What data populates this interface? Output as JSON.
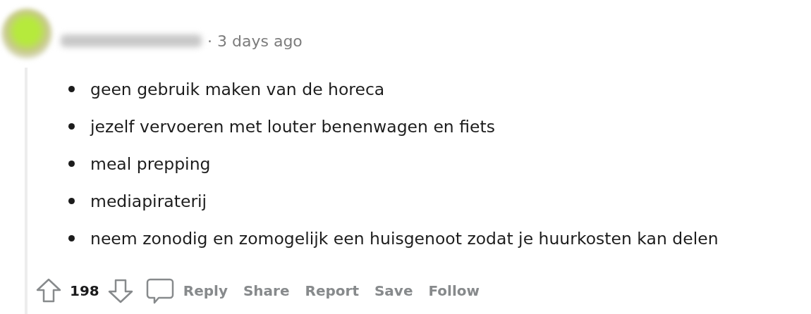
{
  "comment": {
    "timestamp": "· 3 days ago",
    "bullets": [
      "geen gebruik maken van de horeca",
      "jezelf vervoeren met louter benenwagen en fiets",
      "meal prepping",
      "mediapiraterij",
      "neem zonodig en zomogelijk een huisgenoot zodat je huurkosten kan delen"
    ],
    "score": "198",
    "actions": [
      "Reply",
      "Share",
      "Report",
      "Save",
      "Follow"
    ]
  }
}
